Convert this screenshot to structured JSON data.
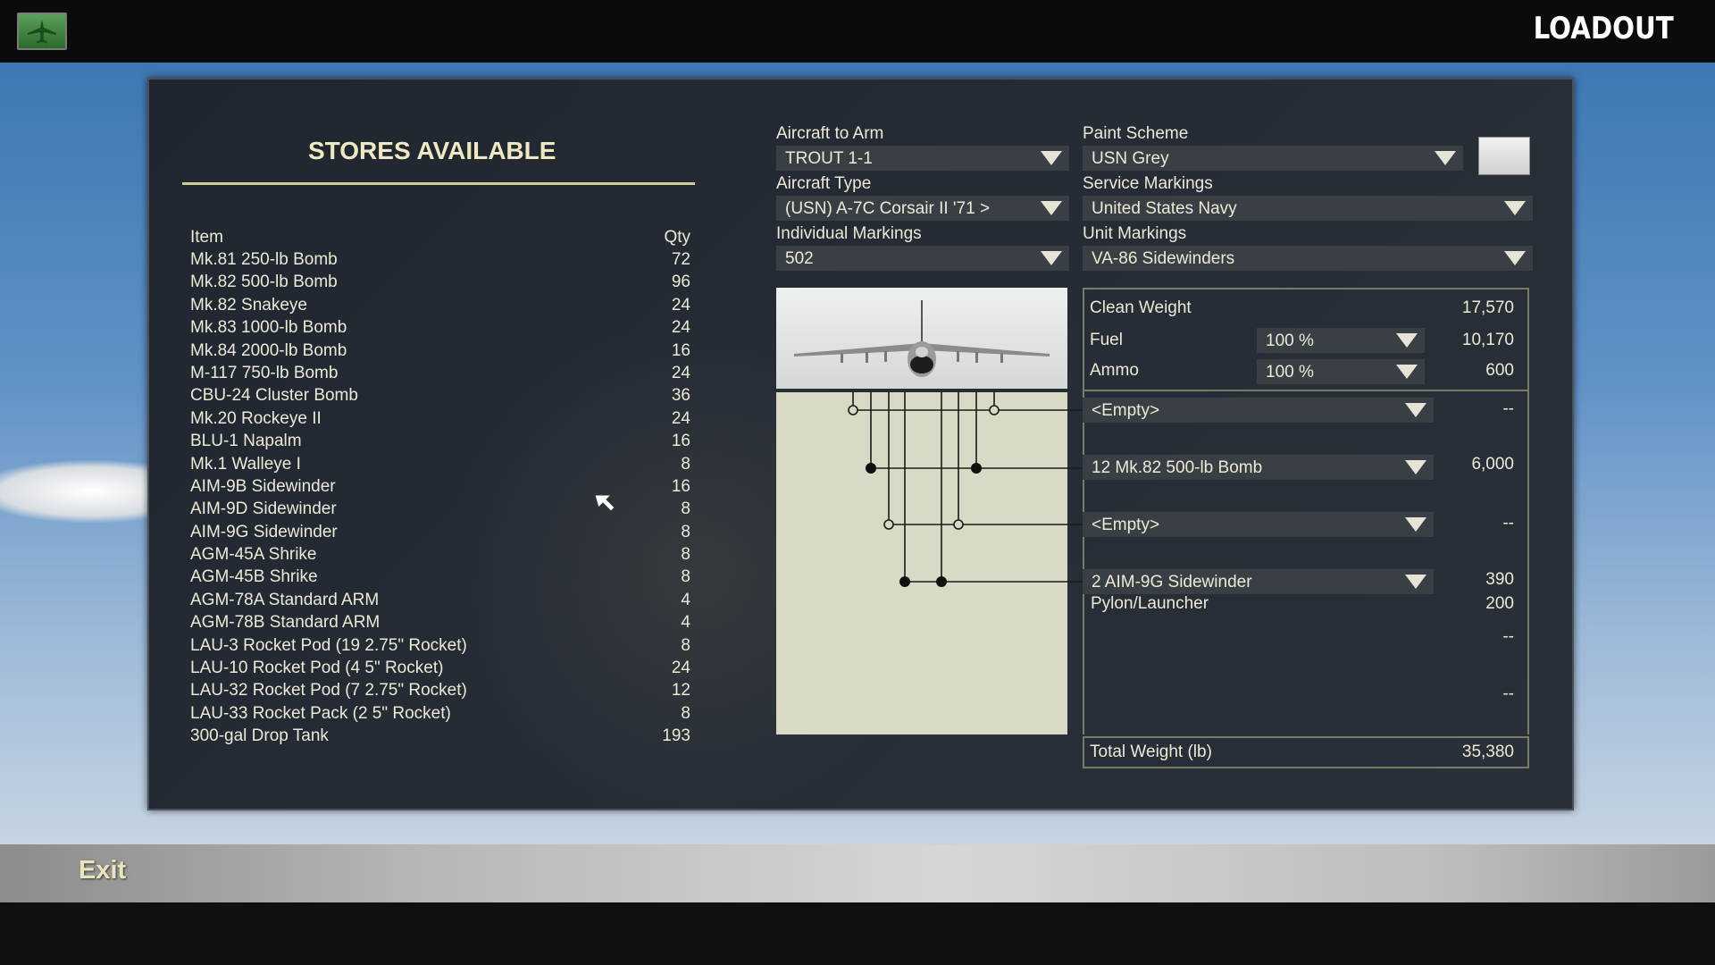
{
  "header": {
    "screen_title": "LOADOUT",
    "home_icon": "aircraft-icon"
  },
  "stores": {
    "title": "STORES AVAILABLE",
    "col_item": "Item",
    "col_qty": "Qty",
    "items": [
      {
        "name": "Mk.81 250-lb Bomb",
        "qty": "72"
      },
      {
        "name": "Mk.82 500-lb Bomb",
        "qty": "96"
      },
      {
        "name": "Mk.82 Snakeye",
        "qty": "24"
      },
      {
        "name": "Mk.83 1000-lb Bomb",
        "qty": "24"
      },
      {
        "name": "Mk.84 2000-lb Bomb",
        "qty": "16"
      },
      {
        "name": "M-117 750-lb Bomb",
        "qty": "24"
      },
      {
        "name": "CBU-24 Cluster Bomb",
        "qty": "36"
      },
      {
        "name": "Mk.20 Rockeye II",
        "qty": "24"
      },
      {
        "name": "BLU-1 Napalm",
        "qty": "16"
      },
      {
        "name": "Mk.1 Walleye I",
        "qty": "8"
      },
      {
        "name": "AIM-9B Sidewinder",
        "qty": "16"
      },
      {
        "name": "AIM-9D Sidewinder",
        "qty": "8"
      },
      {
        "name": "AIM-9G Sidewinder",
        "qty": "8"
      },
      {
        "name": "AGM-45A Shrike",
        "qty": "8"
      },
      {
        "name": "AGM-45B Shrike",
        "qty": "8"
      },
      {
        "name": "AGM-78A Standard ARM",
        "qty": "4"
      },
      {
        "name": "AGM-78B Standard ARM",
        "qty": "4"
      },
      {
        "name": "LAU-3 Rocket Pod (19 2.75\" Rocket)",
        "qty": "8"
      },
      {
        "name": "LAU-10 Rocket Pod (4 5\" Rocket)",
        "qty": "24"
      },
      {
        "name": "LAU-32 Rocket Pod (7 2.75\" Rocket)",
        "qty": "12"
      },
      {
        "name": "LAU-33 Rocket Pack (2 5\" Rocket)",
        "qty": "8"
      },
      {
        "name": "300-gal Drop Tank",
        "qty": "193"
      }
    ]
  },
  "config": {
    "aircraft_to_arm_label": "Aircraft to Arm",
    "aircraft_to_arm": "TROUT 1-1",
    "aircraft_type_label": "Aircraft Type",
    "aircraft_type": "(USN) A-7C Corsair II '71 >",
    "individual_markings_label": "Individual Markings",
    "individual_markings": "502",
    "paint_scheme_label": "Paint Scheme",
    "paint_scheme": "USN Grey",
    "service_markings_label": "Service Markings",
    "service_markings": "United States Navy",
    "unit_markings_label": "Unit Markings",
    "unit_markings": "VA-86 Sidewinders"
  },
  "weights": {
    "clean_weight_label": "Clean Weight",
    "clean_weight": "17,570",
    "fuel_label": "Fuel",
    "fuel_pct": "100 %",
    "fuel_weight": "10,170",
    "ammo_label": "Ammo",
    "ammo_pct": "100 %",
    "ammo_weight": "600",
    "total_label": "Total Weight (lb)",
    "total": "35,380"
  },
  "stations": [
    {
      "store": "<Empty>",
      "weight": "--"
    },
    {
      "store": "12 Mk.82 500-lb Bomb",
      "weight": "6,000"
    },
    {
      "store": "<Empty>",
      "weight": "--"
    },
    {
      "store": "2 AIM-9G Sidewinder",
      "weight": "390"
    }
  ],
  "pylon": {
    "label": "Pylon/Launcher",
    "weight": "200"
  },
  "extra_weights": [
    "--",
    "--"
  ],
  "footer": {
    "exit_label": "Exit"
  }
}
